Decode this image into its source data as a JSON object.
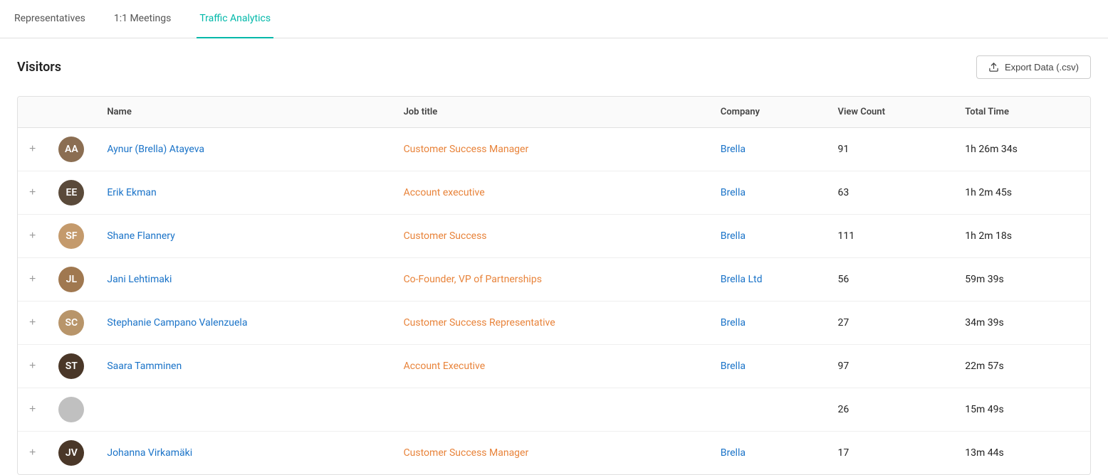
{
  "nav": {
    "tabs": [
      {
        "label": "Representatives",
        "active": false
      },
      {
        "label": "1:1 Meetings",
        "active": false
      },
      {
        "label": "Traffic Analytics",
        "active": true
      }
    ]
  },
  "visitors_section": {
    "title": "Visitors",
    "export_button": "Export Data (.csv)"
  },
  "table": {
    "columns": [
      "",
      "",
      "Name",
      "Job title",
      "Company",
      "View Count",
      "Total Time"
    ],
    "rows": [
      {
        "name": "Aynur (Brella) Atayeva",
        "job_title": "Customer Success Manager",
        "company": "Brella",
        "view_count": "91",
        "total_time": "1h 26m 34s",
        "avatar_initials": "AA",
        "avatar_color": "brown"
      },
      {
        "name": "Erik Ekman",
        "job_title": "Account executive",
        "company": "Brella",
        "view_count": "63",
        "total_time": "1h 2m 45s",
        "avatar_initials": "EE",
        "avatar_color": "dark"
      },
      {
        "name": "Shane Flannery",
        "job_title": "Customer Success",
        "company": "Brella",
        "view_count": "111",
        "total_time": "1h 2m 18s",
        "avatar_initials": "SF",
        "avatar_color": "warm"
      },
      {
        "name": "Jani Lehtimaki",
        "job_title": "Co-Founder, VP of Partnerships",
        "company": "Brella Ltd",
        "view_count": "56",
        "total_time": "59m 39s",
        "avatar_initials": "JL",
        "avatar_color": "medium"
      },
      {
        "name": "Stephanie Campano Valenzuela",
        "job_title": "Customer Success Representative",
        "company": "Brella",
        "view_count": "27",
        "total_time": "34m 39s",
        "avatar_initials": "SC",
        "avatar_color": "light-brown"
      },
      {
        "name": "Saara Tamminen",
        "job_title": "Account Executive",
        "company": "Brella",
        "view_count": "97",
        "total_time": "22m 57s",
        "avatar_initials": "ST",
        "avatar_color": "dark-hair"
      },
      {
        "name": "",
        "job_title": "",
        "company": "",
        "view_count": "26",
        "total_time": "15m 49s",
        "avatar_initials": "",
        "avatar_color": "gray"
      },
      {
        "name": "Johanna Virkamäki",
        "job_title": "Customer Success Manager",
        "company": "Brella",
        "view_count": "17",
        "total_time": "13m 44s",
        "avatar_initials": "JV",
        "avatar_color": "dark-hair"
      }
    ]
  }
}
